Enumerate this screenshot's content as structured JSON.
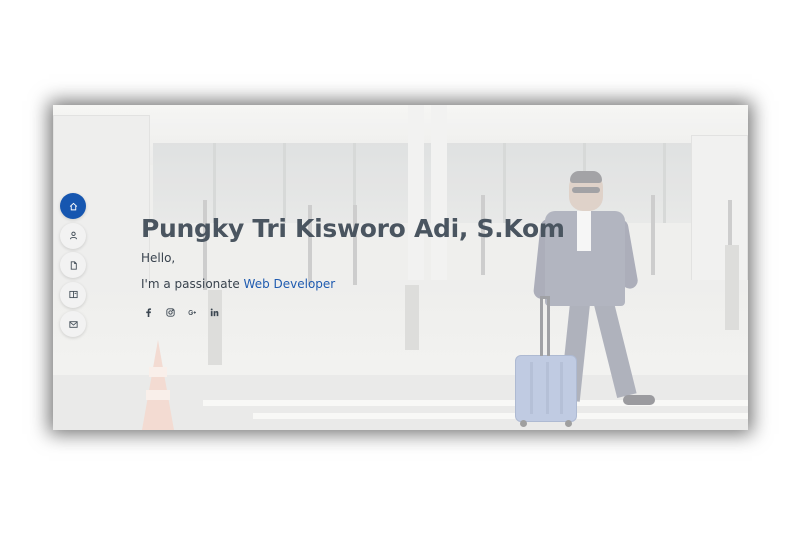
{
  "hero": {
    "name": "Pungky Tri Kisworo Adi, S.Kom",
    "greeting": "Hello,",
    "intro_prefix": "I'm a passionate ",
    "role": "Web Developer"
  },
  "nav": {
    "items": [
      {
        "icon": "home-icon",
        "active": true
      },
      {
        "icon": "person-icon",
        "active": false
      },
      {
        "icon": "file-icon",
        "active": false
      },
      {
        "icon": "book-icon",
        "active": false
      },
      {
        "icon": "envelope-icon",
        "active": false
      }
    ]
  },
  "social": {
    "items": [
      {
        "icon": "facebook-icon"
      },
      {
        "icon": "instagram-icon"
      },
      {
        "icon": "google-plus-icon"
      },
      {
        "icon": "linkedin-icon"
      }
    ]
  },
  "colors": {
    "accent": "#1656b0",
    "title_text": "#4a5560",
    "body_text": "#39434e",
    "role_text": "#1f5bb0",
    "nav_button_bg": "#f2f2f2"
  }
}
